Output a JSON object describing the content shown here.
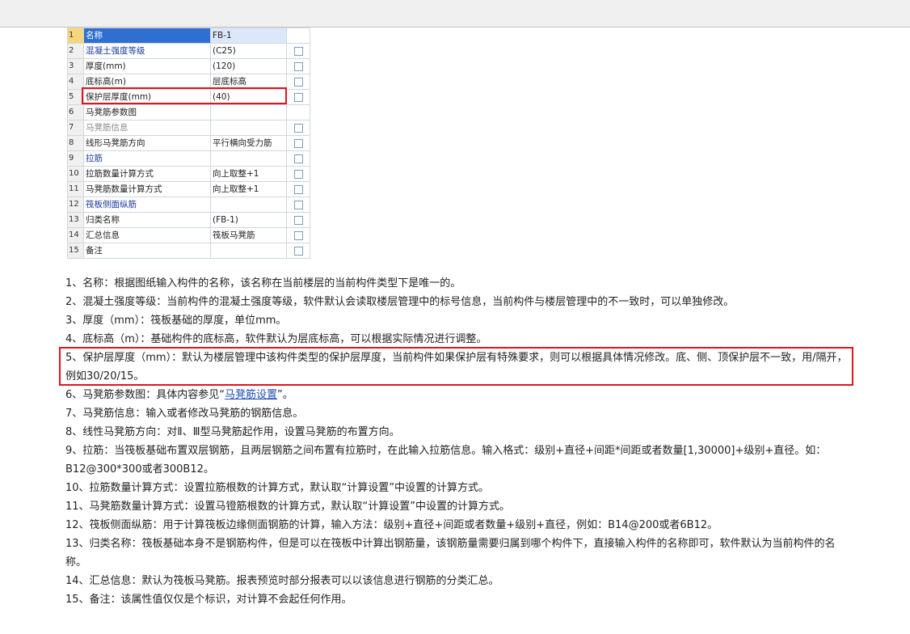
{
  "table": {
    "rows": [
      {
        "num": "1",
        "name": "名称",
        "value": "FB-1",
        "style": "normal",
        "checkbox": false,
        "selected": true
      },
      {
        "num": "2",
        "name": "混凝土强度等级",
        "value": "(C25)",
        "style": "blue",
        "checkbox": true
      },
      {
        "num": "3",
        "name": "厚度(mm)",
        "value": "(120)",
        "style": "normal",
        "checkbox": true
      },
      {
        "num": "4",
        "name": "底标高(m)",
        "value": "层底标高",
        "style": "normal",
        "checkbox": true
      },
      {
        "num": "5",
        "name": "保护层厚度(mm)",
        "value": "(40)",
        "style": "normal",
        "checkbox": true
      },
      {
        "num": "6",
        "name": "马凳筋参数图",
        "value": "",
        "style": "normal",
        "checkbox": false
      },
      {
        "num": "7",
        "name": "马凳筋信息",
        "value": "",
        "style": "gray",
        "checkbox": true
      },
      {
        "num": "8",
        "name": "线形马凳筋方向",
        "value": "平行横向受力筋",
        "style": "normal",
        "checkbox": true
      },
      {
        "num": "9",
        "name": "拉筋",
        "value": "",
        "style": "blue",
        "checkbox": true
      },
      {
        "num": "10",
        "name": "拉筋数量计算方式",
        "value": "向上取整+1",
        "style": "normal",
        "checkbox": true
      },
      {
        "num": "11",
        "name": "马凳筋数量计算方式",
        "value": "向上取整+1",
        "style": "normal",
        "checkbox": true
      },
      {
        "num": "12",
        "name": "筏板侧面纵筋",
        "value": "",
        "style": "blue",
        "checkbox": true
      },
      {
        "num": "13",
        "name": "归类名称",
        "value": "(FB-1)",
        "style": "normal",
        "checkbox": true
      },
      {
        "num": "14",
        "name": "汇总信息",
        "value": "筏板马凳筋",
        "style": "normal",
        "checkbox": true
      },
      {
        "num": "15",
        "name": "备注",
        "value": "",
        "style": "normal",
        "checkbox": true
      }
    ]
  },
  "descriptions": [
    "1、名称：根据图纸输入构件的名称，该名称在当前楼层的当前构件类型下是唯一的。",
    "2、混凝土强度等级：当前构件的混凝土强度等级，软件默认会读取楼层管理中的标号信息，当前构件与楼层管理中的不一致时，可以单独修改。",
    "3、厚度（mm）：筏板基础的厚度，单位mm。",
    "4、底标高（m）：基础构件的底标高，软件默认为层底标高，可以根据实际情况进行调整。",
    "5、保护层厚度（mm）：默认为楼层管理中该构件类型的保护层厚度，当前构件如果保护层有特殊要求，则可以根据具体情况修改。底、侧、顶保护层不一致，用/隔开，例如30/20/15。",
    {
      "before": "6、马凳筋参数图：具体内容参见“",
      "link": "马凳筋设置",
      "after": "”。"
    },
    "7、马凳筋信息：输入或者修改马凳筋的钢筋信息。",
    "8、线性马凳筋方向：对Ⅱ、Ⅲ型马凳筋起作用，设置马凳筋的布置方向。",
    "9、拉筋：当筏板基础布置双层钢筋，且两层钢筋之间布置有拉筋时，在此输入拉筋信息。输入格式：级别+直径+间距*间距或者数量[1,30000]+级别+直径。如：B12@300*300或者300B12。",
    "10、拉筋数量计算方式：设置拉筋根数的计算方式，默认取“计算设置”中设置的计算方式。",
    "11、马凳筋数量计算方式：设置马镫筋根数的计算方式，默认取“计算设置”中设置的计算方式。",
    "12、筏板侧面纵筋：用于计算筏板边缘侧面钢筋的计算，输入方法：级别+直径+间距或者数量+级别+直径，例如：B14@200或者6B12。",
    "13、归类名称：筏板基础本身不是钢筋构件，但是可以在筏板中计算出钢筋量，该钢筋量需要归属到哪个构件下，直接输入构件的名称即可，软件默认为当前构件的名称。",
    "14、汇总信息：默认为筏板马凳筋。报表预览时部分报表可以以该信息进行钢筋的分类汇总。",
    "15、备注：该属性值仅仅是个标识，对计算不会起任何作用。"
  ],
  "colors": {
    "highlight": "#e0141e",
    "link": "#1f4eb5",
    "selected_cell": "#2f6fd1"
  }
}
